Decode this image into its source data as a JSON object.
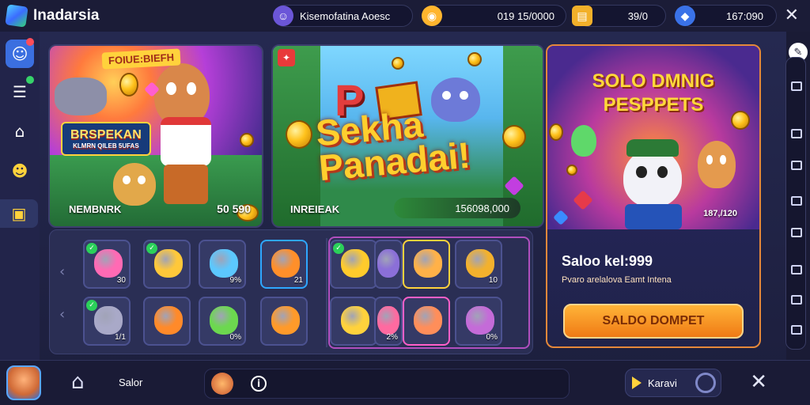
{
  "topbar": {
    "app_name": "Inadarsia",
    "user_text": "Kisemofatina Aoesc",
    "currency1": "019 15/0000",
    "currency2": "39/0",
    "currency3": "167:090",
    "close_icon": "close-icon"
  },
  "sidebar": {
    "items": [
      {
        "icon": "profile-icon"
      },
      {
        "icon": "list-icon"
      },
      {
        "icon": "home-icon"
      },
      {
        "icon": "smile-icon"
      },
      {
        "icon": "clipboard-icon"
      }
    ]
  },
  "banners": {
    "b1": {
      "top_label": "FOIUE:BIEFH",
      "sign_title": "BRSPEKAN",
      "sign_sub": "KLMRN QILEB 5UFAS",
      "caption": "NEMBNRK",
      "amount": "50 590"
    },
    "b2": {
      "title_line1": "Sekha",
      "title_line2": "Panadai!",
      "caption": "INREIEAK",
      "amount": "156098,000"
    },
    "b3": {
      "title_line1": "SOLO DMNIG",
      "title_line2": "PESPPETS",
      "amount": "187,/120",
      "balance_label": "Saloo kel:999",
      "sub_text": "Pvaro arelalova Eamt Intena",
      "button": "SALDO DOMPET"
    }
  },
  "grid": {
    "tiles": [
      {
        "count": "30",
        "color": "#ff6ab4",
        "checked": true
      },
      {
        "count": "",
        "color": "#ffc83a",
        "checked": true
      },
      {
        "count": "9%",
        "color": "#5cc8ff",
        "checked": false
      },
      {
        "count": "21",
        "color": "#ff8f2a",
        "checked": false
      },
      {
        "count": "",
        "color": "#ffcb2c",
        "checked": true
      },
      {
        "count": "",
        "color": "#8b6fd8",
        "checked": false
      },
      {
        "count": "",
        "color": "#ffb148",
        "checked": false
      },
      {
        "count": "10",
        "color": "#f3b12d",
        "checked": false
      },
      {
        "count": "1/1",
        "color": "#a9a9c8",
        "checked": true
      },
      {
        "count": "",
        "color": "#ff8a2a",
        "checked": false
      },
      {
        "count": "0%",
        "color": "#6cd84f",
        "checked": false
      },
      {
        "count": "",
        "color": "#ff9a2a",
        "checked": false
      },
      {
        "count": "",
        "color": "#ffd23c",
        "checked": false
      },
      {
        "count": "2%",
        "color": "#ff6aa0",
        "checked": false
      },
      {
        "count": "",
        "color": "#ff8e5a",
        "checked": false
      },
      {
        "count": "0%",
        "color": "#c46bd8",
        "checked": false
      }
    ]
  },
  "bottombar": {
    "label": "Salor",
    "play_label": "Karavi"
  }
}
